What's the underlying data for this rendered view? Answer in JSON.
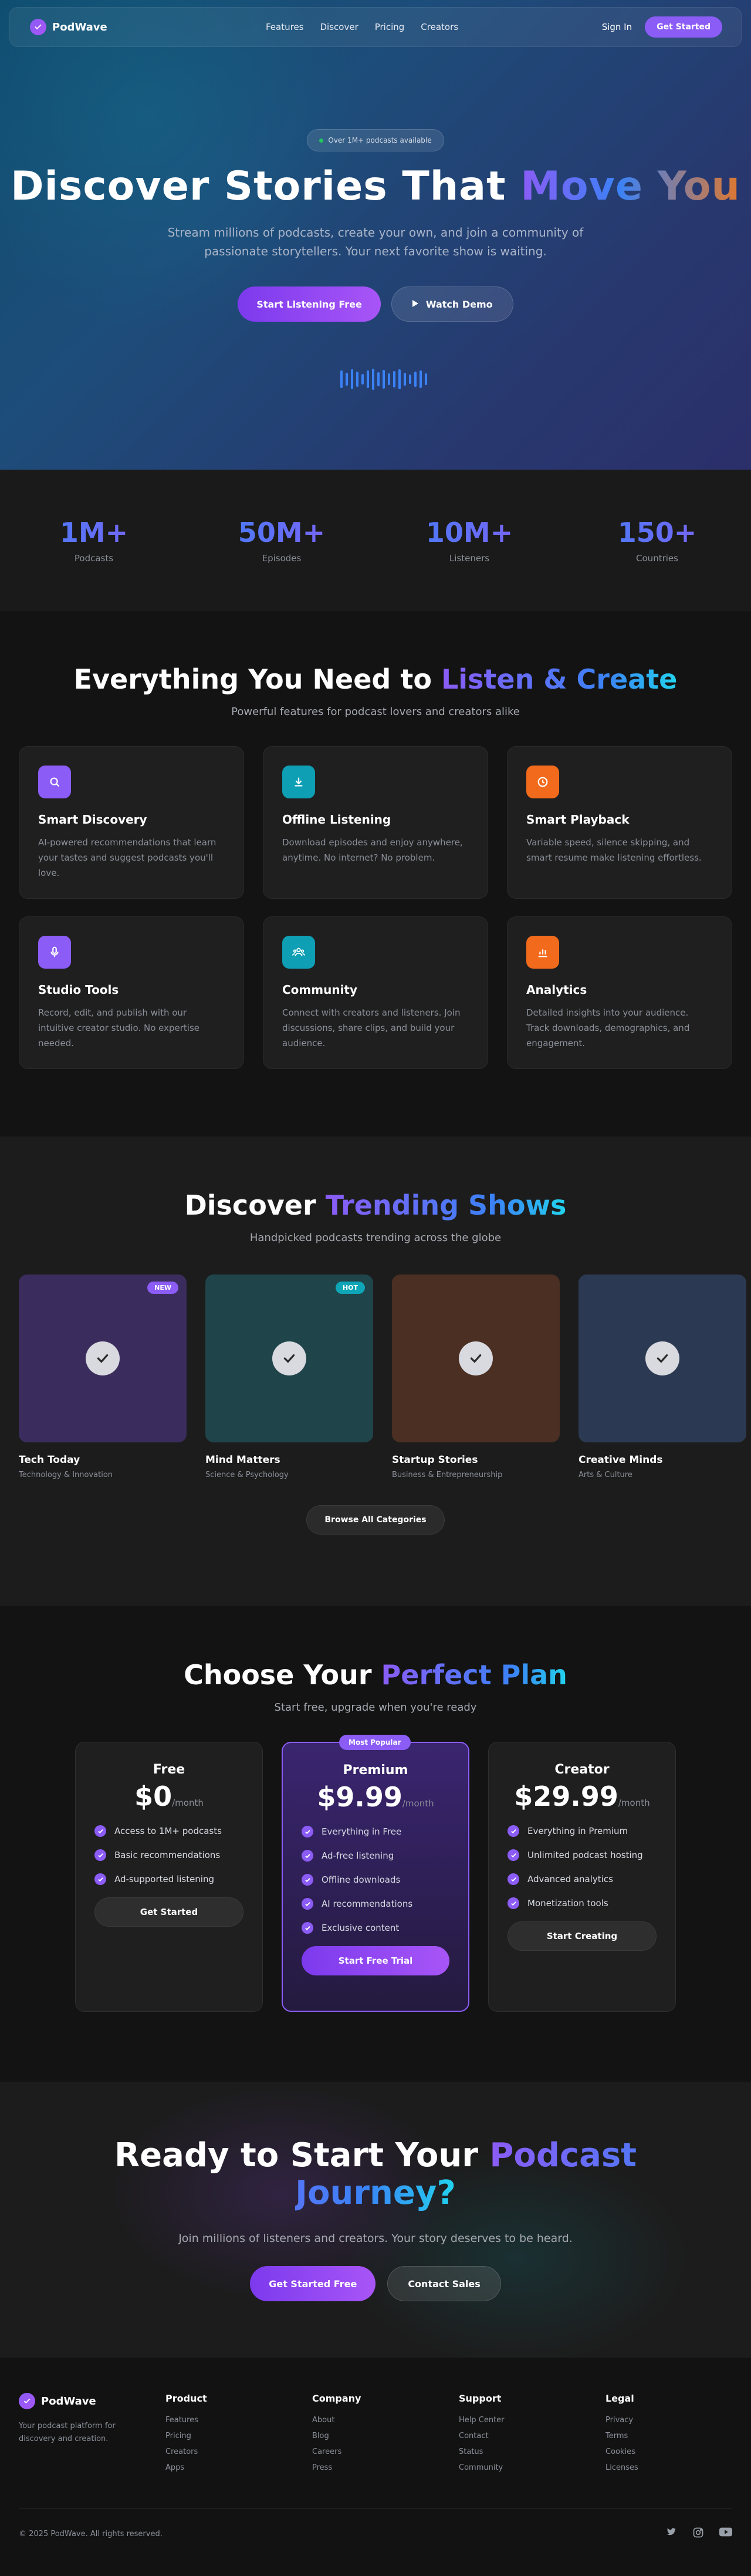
{
  "nav": {
    "brand": "PodWave",
    "links": [
      "Features",
      "Discover",
      "Pricing",
      "Creators"
    ],
    "sign_in": "Sign In",
    "get_started": "Get Started"
  },
  "hero": {
    "badge": "Over 1M+ podcasts available",
    "title_plain": "Discover Stories That ",
    "title_highlight": "Move You",
    "subtitle": "Stream millions of podcasts, create your own, and join a community of passionate storytellers. Your next favorite show is waiting.",
    "primary_button": "Start Listening Free",
    "secondary_button": "Watch Demo"
  },
  "stats": [
    {
      "value": "1M+",
      "label": "Podcasts"
    },
    {
      "value": "50M+",
      "label": "Episodes"
    },
    {
      "value": "10M+",
      "label": "Listeners"
    },
    {
      "value": "150+",
      "label": "Countries"
    }
  ],
  "features": {
    "title_plain": "Everything You Need to ",
    "title_highlight": "Listen & Create",
    "subtitle": "Powerful features for podcast lovers and creators alike",
    "items": [
      {
        "title": "Smart Discovery",
        "desc": "AI-powered recommendations that learn your tastes and suggest podcasts you'll love.",
        "icon": "search-icon",
        "color": "#8b5cf6"
      },
      {
        "title": "Offline Listening",
        "desc": "Download episodes and enjoy anywhere, anytime. No internet? No problem.",
        "icon": "download-icon",
        "color": "#0e9fb5"
      },
      {
        "title": "Smart Playback",
        "desc": "Variable speed, silence skipping, and smart resume make listening effortless.",
        "icon": "clock-icon",
        "color": "#f26a1b"
      },
      {
        "title": "Studio Tools",
        "desc": "Record, edit, and publish with our intuitive creator studio. No expertise needed.",
        "icon": "microphone-icon",
        "color": "#8b5cf6"
      },
      {
        "title": "Community",
        "desc": "Connect with creators and listeners. Join discussions, share clips, and build your audience.",
        "icon": "community-icon",
        "color": "#0e9fb5"
      },
      {
        "title": "Analytics",
        "desc": "Detailed insights into your audience. Track downloads, demographics, and engagement.",
        "icon": "chart-icon",
        "color": "#f26a1b"
      }
    ]
  },
  "trending": {
    "title_plain": "Discover ",
    "title_highlight": "Trending Shows",
    "subtitle": "Handpicked podcasts trending across the globe",
    "shows": [
      {
        "name": "Tech Today",
        "category": "Technology & Innovation",
        "badge": "NEW",
        "badge_color": "#8b5cf6",
        "bg": "#3a2c5c"
      },
      {
        "name": "Mind Matters",
        "category": "Science & Psychology",
        "badge": "HOT",
        "badge_color": "#0ea5b7",
        "bg": "#1f4449"
      },
      {
        "name": "Startup Stories",
        "category": "Business & Entrepreneurship",
        "badge": "",
        "badge_color": "",
        "bg": "#4a2f22"
      },
      {
        "name": "Creative Minds",
        "category": "Arts & Culture",
        "badge": "",
        "badge_color": "",
        "bg": "#2b3a52"
      }
    ],
    "browse_button": "Browse All Categories"
  },
  "pricing": {
    "title_plain": "Choose Your ",
    "title_highlight": "Perfect Plan",
    "subtitle": "Start free, upgrade when you're ready",
    "popular_label": "Most Popular",
    "plans": [
      {
        "name": "Free",
        "price": "$0",
        "period": "/month",
        "features": [
          "Access to 1M+ podcasts",
          "Basic recommendations",
          "Ad-supported listening"
        ],
        "button": "Get Started"
      },
      {
        "name": "Premium",
        "price": "$9.99",
        "period": "/month",
        "features": [
          "Everything in Free",
          "Ad-free listening",
          "Offline downloads",
          "AI recommendations",
          "Exclusive content"
        ],
        "button": "Start Free Trial"
      },
      {
        "name": "Creator",
        "price": "$29.99",
        "period": "/month",
        "features": [
          "Everything in Premium",
          "Unlimited podcast hosting",
          "Advanced analytics",
          "Monetization tools"
        ],
        "button": "Start Creating"
      }
    ]
  },
  "cta": {
    "title_plain": "Ready to Start Your ",
    "title_highlight": "Podcast Journey?",
    "subtitle": "Join millions of listeners and creators. Your story deserves to be heard.",
    "primary_button": "Get Started Free",
    "secondary_button": "Contact Sales"
  },
  "footer": {
    "brand": "PodWave",
    "tagline": "Your podcast platform for discovery and creation.",
    "columns": [
      {
        "title": "Product",
        "links": [
          "Features",
          "Pricing",
          "Creators",
          "Apps"
        ]
      },
      {
        "title": "Company",
        "links": [
          "About",
          "Blog",
          "Careers",
          "Press"
        ]
      },
      {
        "title": "Support",
        "links": [
          "Help Center",
          "Contact",
          "Status",
          "Community"
        ]
      },
      {
        "title": "Legal",
        "links": [
          "Privacy",
          "Terms",
          "Cookies",
          "Licenses"
        ]
      }
    ],
    "copyright": "© 2025 PodWave. All rights reserved.",
    "social": [
      "twitter-icon",
      "instagram-icon",
      "youtube-icon"
    ]
  }
}
